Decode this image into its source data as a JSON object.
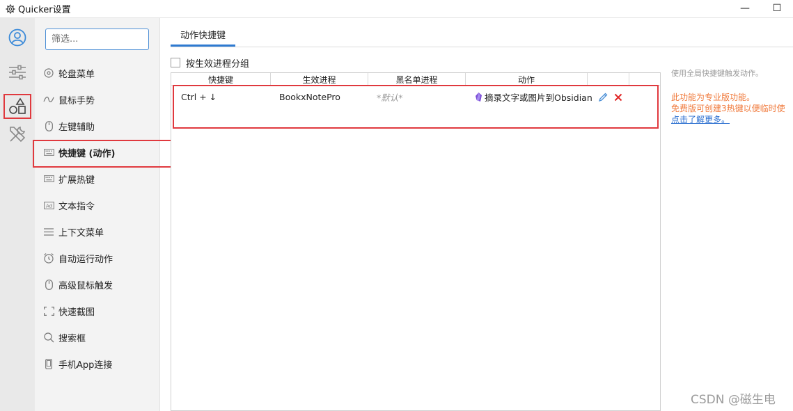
{
  "window": {
    "title": "Quicker设置",
    "minimize_glyph": "—",
    "maximize_glyph": "☐"
  },
  "iconbar": {
    "items": [
      {
        "icon": "user-circle-icon",
        "active": false
      },
      {
        "icon": "sliders-icon",
        "active": false
      },
      {
        "icon": "shapes-icon",
        "active": true
      },
      {
        "icon": "tools-icon",
        "active": false
      }
    ]
  },
  "nav": {
    "filter_placeholder": "筛选...",
    "items": [
      {
        "label": "轮盘菜单",
        "icon": "wheel-icon"
      },
      {
        "label": "鼠标手势",
        "icon": "gesture-icon"
      },
      {
        "label": "左键辅助",
        "icon": "mouse-icon"
      },
      {
        "label": "快捷键 (动作)",
        "icon": "keyboard-icon",
        "active": true
      },
      {
        "label": "扩展热键",
        "icon": "keyboard-icon"
      },
      {
        "label": "文本指令",
        "icon": "ad-text-icon"
      },
      {
        "label": "上下文菜单",
        "icon": "menu-lines-icon"
      },
      {
        "label": "自动运行动作",
        "icon": "alarm-clock-icon"
      },
      {
        "label": "高级鼠标触发",
        "icon": "mouse-icon"
      },
      {
        "label": "快速截图",
        "icon": "screenshot-icon"
      },
      {
        "label": "搜索框",
        "icon": "search-icon"
      },
      {
        "label": "手机App连接",
        "icon": "phone-icon"
      }
    ]
  },
  "main": {
    "tab_label": "动作快捷键",
    "group_by_process_label": "按生效进程分组",
    "columns": [
      "快捷键",
      "生效进程",
      "黑名单进程",
      "动作"
    ],
    "rows": [
      {
        "hotkey": "Ctrl + ↓",
        "process": "BookxNotePro",
        "blacklist": "*默认*",
        "action": "摘录文字或图片到Obsidian"
      }
    ]
  },
  "info": {
    "description": "使用全局快捷键触发动作。",
    "pro_notice": "此功能为专业版功能。",
    "free_notice": "免费版可创建3热键以便临时使",
    "learn_more": "点击了解更多。"
  },
  "watermark": "CSDN @磁生电",
  "colors": {
    "accent": "#2e7ad1",
    "highlight_box": "#e0393e",
    "pro_orange": "#f07a3c",
    "link_blue": "#2b6fd0",
    "obsidian_purple": "#7c4dd6",
    "delete_red": "#e02424"
  }
}
